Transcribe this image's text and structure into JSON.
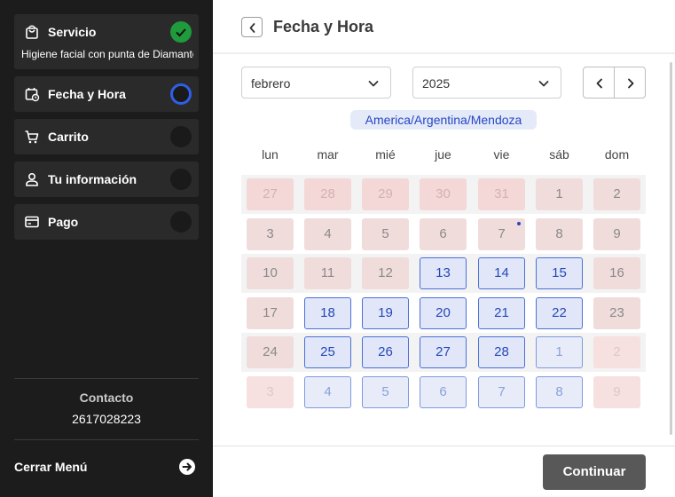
{
  "sidebar": {
    "steps": [
      {
        "label": "Servicio",
        "subtitle": "Higiene facial con punta de Diamante",
        "status": "done",
        "icon": "bag-icon"
      },
      {
        "label": "Fecha y Hora",
        "status": "current",
        "icon": "calendar-clock-icon"
      },
      {
        "label": "Carrito",
        "status": "pending",
        "icon": "cart-icon"
      },
      {
        "label": "Tu información",
        "status": "pending",
        "icon": "user-icon"
      },
      {
        "label": "Pago",
        "status": "pending",
        "icon": "card-icon"
      }
    ],
    "contact_title": "Contacto",
    "contact_phone": "2617028223",
    "close_menu": "Cerrar Menú"
  },
  "header": {
    "title": "Fecha y Hora"
  },
  "calendar": {
    "month": "febrero",
    "year": "2025",
    "timezone": "America/Argentina/Mendoza",
    "weekdays": [
      "lun",
      "mar",
      "mié",
      "jue",
      "vie",
      "sáb",
      "dom"
    ],
    "weeks": [
      [
        {
          "d": "27",
          "s": "prev"
        },
        {
          "d": "28",
          "s": "prev"
        },
        {
          "d": "29",
          "s": "prev"
        },
        {
          "d": "30",
          "s": "prev"
        },
        {
          "d": "31",
          "s": "prev"
        },
        {
          "d": "1",
          "s": "dis"
        },
        {
          "d": "2",
          "s": "dis"
        }
      ],
      [
        {
          "d": "3",
          "s": "dis"
        },
        {
          "d": "4",
          "s": "dis"
        },
        {
          "d": "5",
          "s": "dis"
        },
        {
          "d": "6",
          "s": "dis"
        },
        {
          "d": "7",
          "s": "dis",
          "today": true
        },
        {
          "d": "8",
          "s": "dis"
        },
        {
          "d": "9",
          "s": "dis"
        }
      ],
      [
        {
          "d": "10",
          "s": "dis"
        },
        {
          "d": "11",
          "s": "dis"
        },
        {
          "d": "12",
          "s": "dis"
        },
        {
          "d": "13",
          "s": "avail"
        },
        {
          "d": "14",
          "s": "avail"
        },
        {
          "d": "15",
          "s": "avail"
        },
        {
          "d": "16",
          "s": "dis"
        }
      ],
      [
        {
          "d": "17",
          "s": "dis"
        },
        {
          "d": "18",
          "s": "avail"
        },
        {
          "d": "19",
          "s": "avail"
        },
        {
          "d": "20",
          "s": "avail"
        },
        {
          "d": "21",
          "s": "avail"
        },
        {
          "d": "22",
          "s": "avail"
        },
        {
          "d": "23",
          "s": "dis"
        }
      ],
      [
        {
          "d": "24",
          "s": "dis"
        },
        {
          "d": "25",
          "s": "avail"
        },
        {
          "d": "26",
          "s": "avail"
        },
        {
          "d": "27",
          "s": "avail"
        },
        {
          "d": "28",
          "s": "avail"
        },
        {
          "d": "1",
          "s": "nextav"
        },
        {
          "d": "2",
          "s": "nextdis"
        }
      ],
      [
        {
          "d": "3",
          "s": "nextdis"
        },
        {
          "d": "4",
          "s": "nextav"
        },
        {
          "d": "5",
          "s": "nextav"
        },
        {
          "d": "6",
          "s": "nextav"
        },
        {
          "d": "7",
          "s": "nextav"
        },
        {
          "d": "8",
          "s": "nextav"
        },
        {
          "d": "9",
          "s": "nextdis"
        }
      ]
    ]
  },
  "footer": {
    "continue_label": "Continuar"
  },
  "colors": {
    "accent": "#2f5ee8",
    "done": "#1f9a3c",
    "sidebar_bg": "#1c1c1c",
    "button_bg": "#585858"
  }
}
